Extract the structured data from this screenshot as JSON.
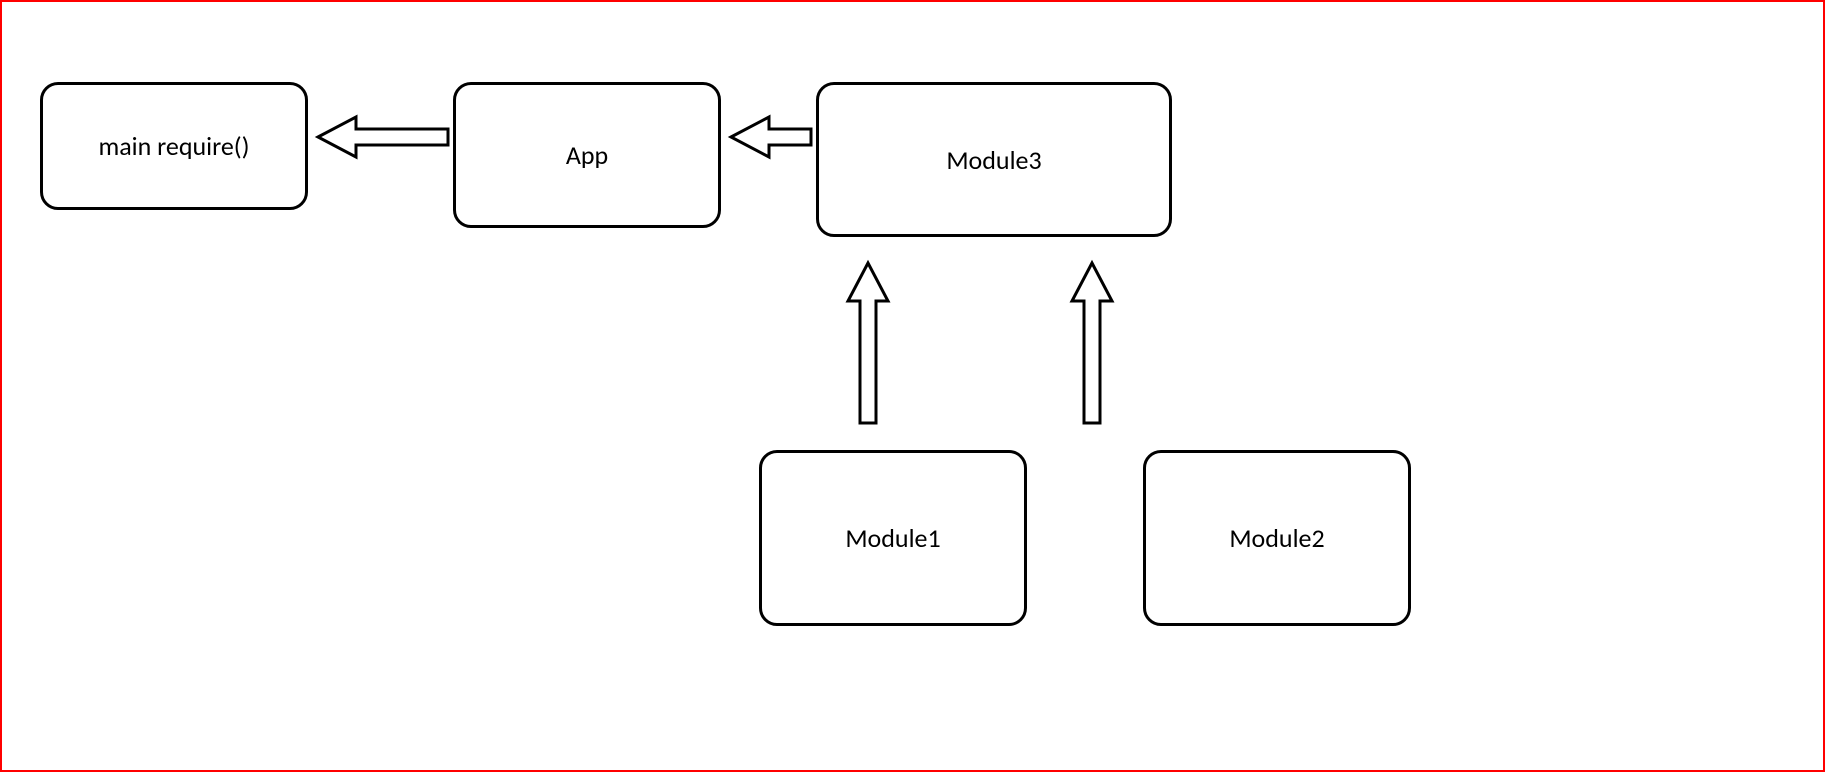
{
  "nodes": {
    "main_require": {
      "label": "main require()"
    },
    "app": {
      "label": "App"
    },
    "module3": {
      "label": "Module3"
    },
    "module1": {
      "label": "Module1"
    },
    "module2": {
      "label": "Module2"
    }
  },
  "edges": [
    {
      "from": "app",
      "to": "main_require",
      "direction": "left"
    },
    {
      "from": "module3",
      "to": "app",
      "direction": "left"
    },
    {
      "from": "module1",
      "to": "module3",
      "direction": "up"
    },
    {
      "from": "module2",
      "to": "module3",
      "direction": "up"
    }
  ],
  "diagram_type": "dependency-graph"
}
